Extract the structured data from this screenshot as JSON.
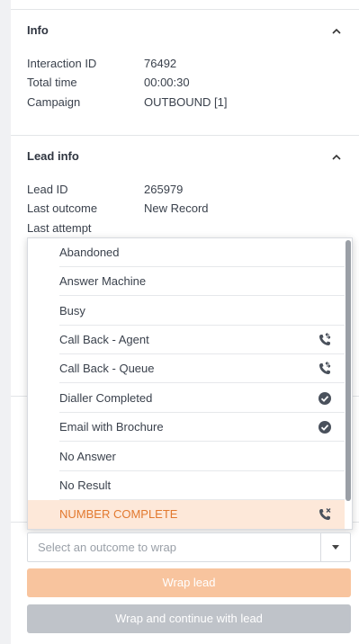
{
  "info": {
    "title": "Info",
    "rows": [
      {
        "label": "Interaction ID",
        "value": "76492"
      },
      {
        "label": "Total time",
        "value": "00:00:30"
      },
      {
        "label": "Campaign",
        "value": "OUTBOUND [1]"
      }
    ]
  },
  "lead_info": {
    "title": "Lead info",
    "rows": [
      {
        "label": "Lead ID",
        "value": "265979"
      },
      {
        "label": "Last outcome",
        "value": "New Record"
      },
      {
        "label": "Last attempt",
        "value": ""
      }
    ]
  },
  "outcomes": [
    {
      "label": "Abandoned",
      "icon": ""
    },
    {
      "label": "Answer Machine",
      "icon": ""
    },
    {
      "label": "Busy",
      "icon": ""
    },
    {
      "label": "Call Back - Agent",
      "icon": "phone-callback-icon"
    },
    {
      "label": "Call Back - Queue",
      "icon": "phone-callback-icon"
    },
    {
      "label": "Dialler Completed",
      "icon": "check-circle-icon"
    },
    {
      "label": "Email with Brochure",
      "icon": "check-circle-icon"
    },
    {
      "label": "No Answer",
      "icon": ""
    },
    {
      "label": "No Result",
      "icon": ""
    },
    {
      "label": "NUMBER COMPLETE",
      "icon": "phone-cancel-icon"
    }
  ],
  "outcome_select": {
    "placeholder": "Select an outcome to wrap"
  },
  "buttons": {
    "wrap_lead": "Wrap lead",
    "wrap_continue": "Wrap and continue with lead"
  },
  "colors": {
    "highlight_bg": "#fde8d9",
    "highlight_text": "#e2792f",
    "wrap_btn": "#f8c49e",
    "disabled_btn": "#bfc3c9"
  }
}
